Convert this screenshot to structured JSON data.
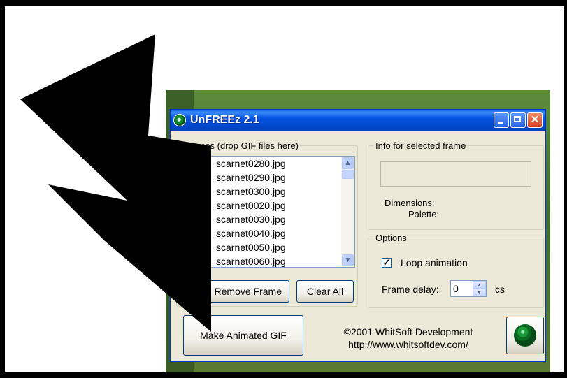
{
  "window": {
    "title": "UnFREEz 2.1"
  },
  "frames": {
    "legend": "Frames (drop GIF files here)",
    "items": [
      "scarnet0280.jpg",
      "scarnet0290.jpg",
      "scarnet0300.jpg",
      "scarnet0020.jpg",
      "scarnet0030.jpg",
      "scarnet0040.jpg",
      "scarnet0050.jpg",
      "scarnet0060.jpg"
    ],
    "remove_label": "Remove Frame",
    "clear_label": "Clear All"
  },
  "info": {
    "legend": "Info for selected frame",
    "dimensions_label": "Dimensions:",
    "palette_label": "Palette:"
  },
  "options": {
    "legend": "Options",
    "loop_label": "Loop animation",
    "loop_checked": true,
    "check_glyph": "✓",
    "delay_label": "Frame delay:",
    "delay_value": "0",
    "delay_unit": "cs"
  },
  "footer": {
    "make_label": "Make Animated GIF",
    "copyright": "©2001 WhitSoft Development",
    "url": "http://www.whitsoftdev.com/"
  },
  "colors": {
    "titlebar": "#0554e3",
    "window_bg": "#ece9d8",
    "close": "#d6401c"
  }
}
